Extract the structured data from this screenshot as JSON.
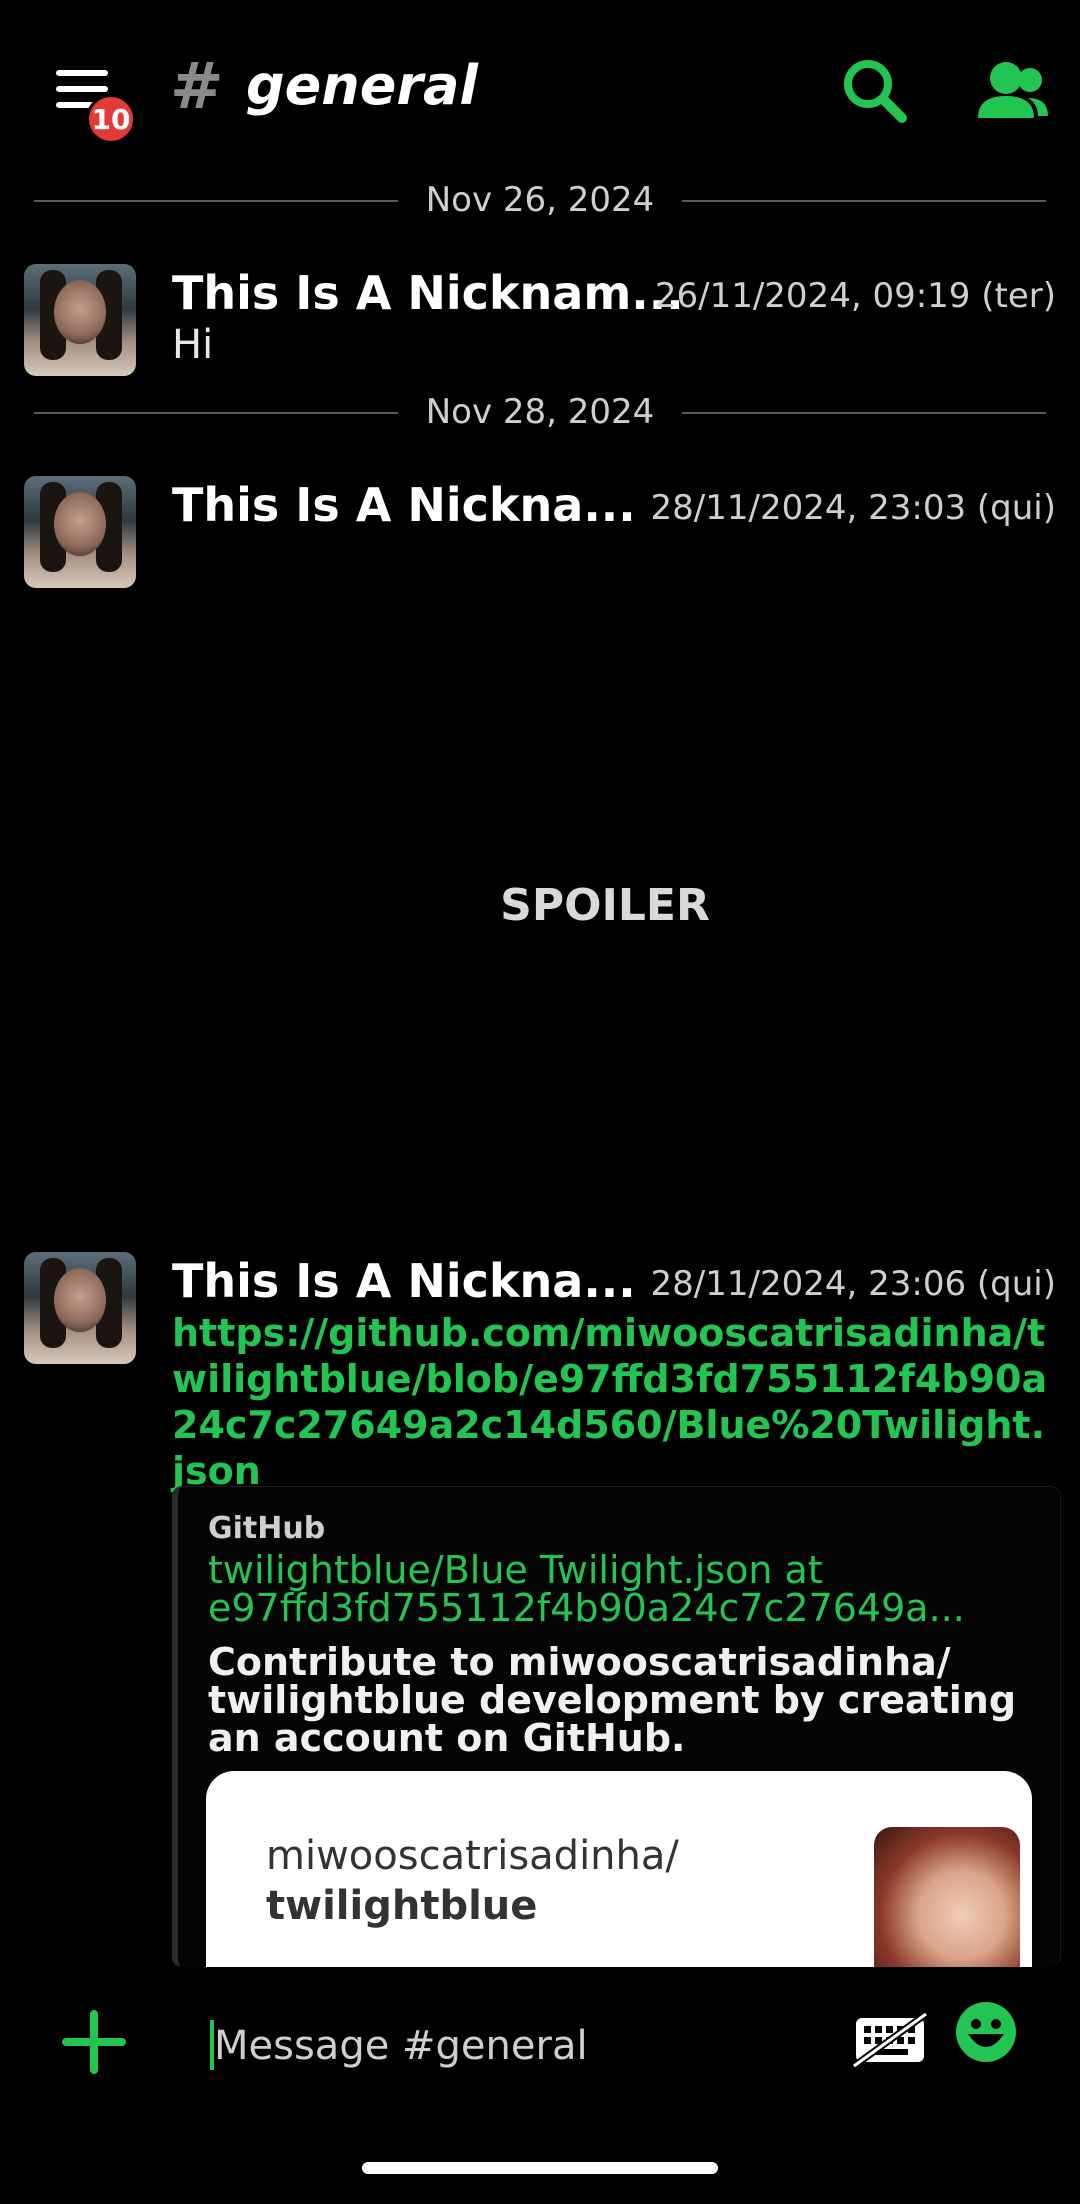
{
  "header": {
    "badge_count": "10",
    "hash": "#",
    "channel_name": "general"
  },
  "messages": [
    {
      "date_separator": "Nov 26, 2024",
      "author": "This Is A Nicknam...",
      "timestamp": "26/11/2024, 09:19 (ter)",
      "text": "Hi"
    },
    {
      "date_separator": "Nov 28, 2024",
      "author": "This Is A Nickna...",
      "timestamp": "28/11/2024, 23:03 (qui)",
      "spoiler_label": "SPOILER"
    },
    {
      "author": "This Is A Nickna...",
      "timestamp": "28/11/2024, 23:06 (qui)",
      "link": "https://github.com/miwooscatrisadinha/twilightblue/blob/e97ffd3fd755112f4b90a24c7c27649a2c14d560/Blue%20Twilight.json",
      "embed": {
        "provider": "GitHub",
        "title": "twilightblue/Blue Twilight.json at e97ffd3fd755112f4b90a24c7c27649a...",
        "description": "Contribute to miwooscatrisadinha/ twilightblue development by creating an account on GitHub.",
        "card_owner": "miwooscatrisadinha/",
        "card_repo": "twilightblue"
      }
    }
  ],
  "composer": {
    "placeholder": "Message #general"
  },
  "colors": {
    "accent": "#23c552",
    "badge": "#e53935",
    "background": "#000000"
  },
  "icons": {
    "menu": "menu-icon",
    "search": "search-icon",
    "members": "members-icon",
    "add": "plus-icon",
    "keyboard": "keyboard-off-icon",
    "emoji": "emoji-icon"
  }
}
